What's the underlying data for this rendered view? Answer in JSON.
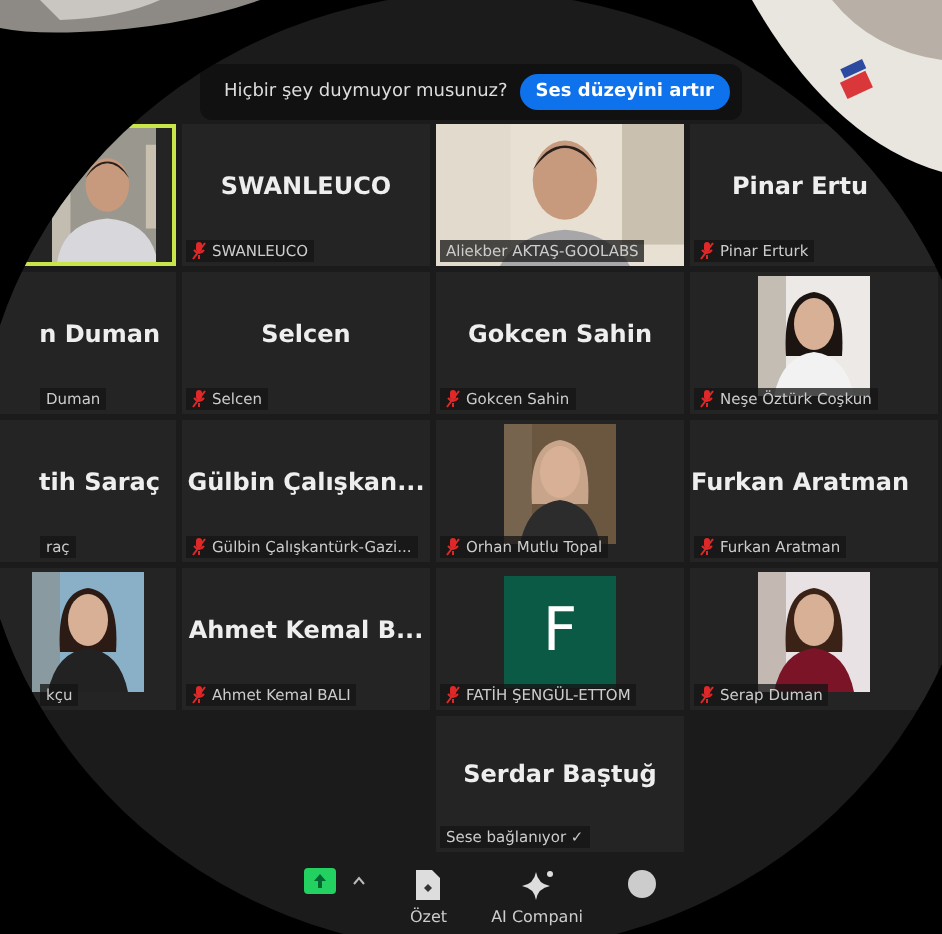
{
  "banner": {
    "text": "Hiçbir şey duymuyor musunuz?",
    "button": "Ses düzeyini artır"
  },
  "tiles": [
    {
      "kind": "video",
      "speaking": true
    },
    {
      "kind": "name",
      "name": "SWANLEUCO",
      "label": "SWANLEUCO",
      "muted": true
    },
    {
      "kind": "video",
      "label": "Aliekber AKTAŞ-GOOLABS",
      "muted": false
    },
    {
      "kind": "name",
      "name": "Pinar Ertu",
      "label": "Pinar Erturk",
      "muted": true
    },
    {
      "kind": "name",
      "name": "n Duman",
      "label": "Duman"
    },
    {
      "kind": "name",
      "name": "Selcen",
      "label": "Selcen",
      "muted": true
    },
    {
      "kind": "name",
      "name": "Gokcen Sahin",
      "label": "Gokcen Sahin",
      "muted": true
    },
    {
      "label": "Neşe Öztürk Coşkun",
      "muted": true
    },
    {
      "kind": "name",
      "name": "tih Saraç",
      "label": "raç"
    },
    {
      "kind": "name",
      "name": "Gülbin  Çalışkan...",
      "label": "Gülbin Çalışkantürk-Gazi...",
      "muted": true
    },
    {
      "label": "Orhan Mutlu Topal",
      "muted": true
    },
    {
      "kind": "name",
      "name": "Furkan Aratman",
      "label": "Furkan Aratman",
      "muted": true
    },
    {
      "label": "kçu"
    },
    {
      "kind": "name",
      "name": "Ahmet Kemal B...",
      "label": "Ahmet Kemal BALI",
      "muted": true
    },
    {
      "kind": "initial",
      "name": "F",
      "label": "FATİH ŞENGÜL-ETTOM",
      "muted": true
    },
    {
      "label": "Serap Duman",
      "muted": true
    }
  ],
  "last_row": [
    {
      "kind": "name",
      "name": "Serdar Baştuğ",
      "label": "Sese bağlanıyor ✓",
      "muted": false
    }
  ],
  "toolbar": [
    {
      "kind": "share"
    },
    {
      "kind": "summary",
      "label": "Özet"
    },
    {
      "kind": "ai",
      "label": "AI Compani"
    },
    {
      "kind": "more"
    }
  ]
}
